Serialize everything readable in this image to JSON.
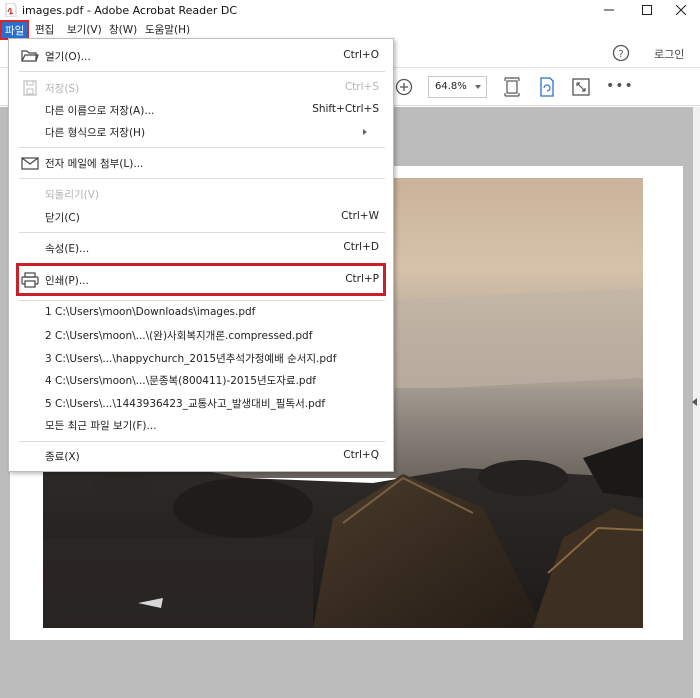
{
  "window": {
    "title": "images.pdf - Adobe Acrobat Reader DC",
    "icon": "acrobat-pdf-icon",
    "controls": [
      "minimize",
      "maximize",
      "close"
    ]
  },
  "menubar": {
    "items": [
      {
        "label": "파일"
      },
      {
        "label": "편집"
      },
      {
        "label": "보기(V)"
      },
      {
        "label": "창(W)"
      },
      {
        "label": "도움말(H)"
      }
    ]
  },
  "header": {
    "login_label": "로그인"
  },
  "toolbar": {
    "zoom_value": "64.8%"
  },
  "file_menu": {
    "open": {
      "label": "열기(O)...",
      "shortcut": "Ctrl+O"
    },
    "save": {
      "label": "저장(S)",
      "shortcut": "Ctrl+S"
    },
    "save_as": {
      "label": "다른 이름으로 저장(A)...",
      "shortcut": "Shift+Ctrl+S"
    },
    "save_as_other": {
      "label": "다른 형식으로 저장(H)"
    },
    "attach_email": {
      "label": "전자 메일에 첨부(L)..."
    },
    "revert": {
      "label": "되돌리기(V)"
    },
    "close": {
      "label": "닫기(C)",
      "shortcut": "Ctrl+W"
    },
    "properties": {
      "label": "속성(E)...",
      "shortcut": "Ctrl+D"
    },
    "print": {
      "label": "인쇄(P)...",
      "shortcut": "Ctrl+P"
    },
    "recent_files": [
      "1 C:\\Users\\moon\\Downloads\\images.pdf",
      "2 C:\\Users\\moon\\...\\(완)사회복지개론.compressed.pdf",
      "3 C:\\Users\\...\\happychurch_2015년추석가정예배 순서지.pdf",
      "4 C:\\Users\\moon\\...\\문종복(800411)-2015년도자료.pdf",
      "5 C:\\Users\\...\\1443936423_교통사고_발생대비_필독서.pdf"
    ],
    "view_all_recent": {
      "label": "모든 최근 파일 보기(F)..."
    },
    "exit": {
      "label": "종료(X)",
      "shortcut": "Ctrl+Q"
    }
  },
  "colors": {
    "menu_highlight": "#2b6fce",
    "annotation_red": "#c9202c",
    "doc_background": "#bcbcbc"
  }
}
